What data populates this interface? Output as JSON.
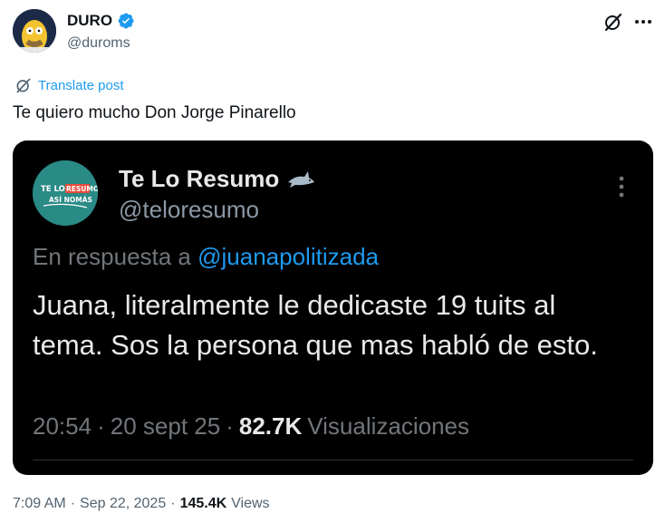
{
  "post": {
    "author_name": "DURO",
    "author_handle": "@duroms",
    "translate_label": "Translate post",
    "text": "Te quiero mucho Don Jorge Pinarello",
    "time": "7:09 AM",
    "separator": "·",
    "date": "Sep 22, 2025",
    "views_count": "145.4K",
    "views_label": "Views"
  },
  "quote": {
    "author_name": "Te Lo Resumo",
    "author_handle": "@teloresumo",
    "reply_prefix": "En respuesta a",
    "reply_to": "@juanapolitizada",
    "text": "Juana, literalmente le dedicaste 19 tuits al tema. Sos la persona que mas habló de esto.",
    "time": "20:54",
    "separator": "·",
    "date": "20 sept 25",
    "views_count": "82.7K",
    "views_label": "Visualizaciones",
    "avatar_text_line1": "TE LO RESUMO",
    "avatar_text_line2": "ASÍ NOMÁS"
  },
  "icons": {
    "verified": "verified-badge-icon",
    "grok": "grok-icon",
    "more": "more-horizontal-icon",
    "translate": "translate-icon",
    "shark": "shark-icon",
    "quote_more": "more-vertical-icon"
  },
  "colors": {
    "accent": "#1d9bf0",
    "text": "#0f1419",
    "secondary": "#536471",
    "quote_bg": "#000000"
  }
}
